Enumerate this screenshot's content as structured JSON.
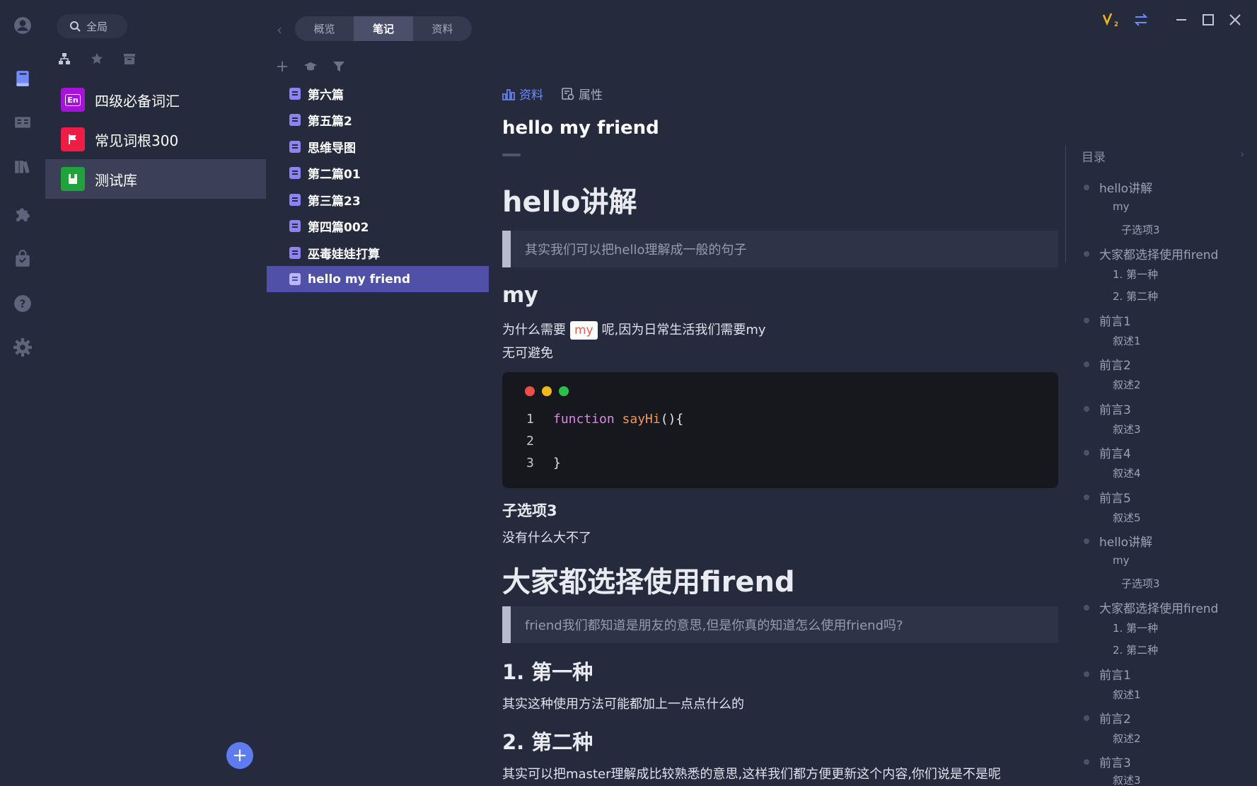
{
  "colors": {
    "accent": "#6e8cff",
    "sidebar_bg": "#262a3d",
    "active_note": "#5051a6",
    "lib_colors": [
      "#a413d7",
      "#ef1c44",
      "#21a33b"
    ]
  },
  "rail": {
    "icons": [
      "avatar-icon",
      "book-icon",
      "cards-icon",
      "library-icon",
      "puzzle-icon",
      "bag-icon",
      "help-icon",
      "gear-icon"
    ]
  },
  "library": {
    "search_label": "全局",
    "items": [
      {
        "label": "四级必备词汇",
        "badge": "En"
      },
      {
        "label": "常见词根300",
        "badge": ""
      },
      {
        "label": "测试库",
        "badge": ""
      }
    ]
  },
  "notes": {
    "tabs": [
      "概览",
      "笔记",
      "资料"
    ],
    "items": [
      "第六篇",
      "第五篇2",
      "思维导图",
      "第二篇01",
      "第三篇23",
      "第四篇002",
      "巫毒娃娃打算",
      "hello my friend"
    ]
  },
  "doc": {
    "tab_material": "资料",
    "tab_props": "属性",
    "title": "hello my friend",
    "h1_a": "hello讲解",
    "quote_a": "其实我们可以把hello理解成一般的句子",
    "h2_my": "my",
    "p_my_pre": "为什么需要",
    "p_my_code": "my",
    "p_my_post": "呢,因为日常生活我们需要my",
    "p_my_2": "无可避免",
    "code": {
      "ln1": "1",
      "ln2": "2",
      "ln3": "3",
      "kw": "function",
      "fn": "sayHi",
      "punc": "(){",
      "close": "}"
    },
    "h4_sub": "子选项3",
    "p_sub": "没有什么大不了",
    "h1_b": "大家都选择使用firend",
    "quote_b": "friend我们都知道是朋友的意思,但是你真的知道怎么使用friend吗?",
    "h3_1": "1. 第一种",
    "p_1": "其实这种使用方法可能都加上一点点什么的",
    "h3_2": "2. 第二种",
    "p_2": "其实可以把master理解成比较熟悉的意思,这样我们都方便更新这个内容,你们说是不是呢"
  },
  "toc": {
    "title": "目录",
    "items": [
      "hello讲解",
      "my",
      "子选项3",
      "大家都选择使用firend",
      "1. 第一种",
      "2. 第二种",
      "前言1",
      "叙述1",
      "前言2",
      "叙述2",
      "前言3",
      "叙述3",
      "前言4",
      "叙述4",
      "前言5",
      "叙述5",
      "hello讲解",
      "my",
      "子选项3",
      "大家都选择使用firend",
      "1. 第一种",
      "2. 第二种",
      "前言1",
      "叙述1",
      "前言2",
      "叙述2",
      "前言3",
      "叙述3"
    ]
  },
  "titlebar": {
    "icons": [
      "v2-badge-icon",
      "swap-icon",
      "minimize-icon",
      "maximize-icon",
      "close-icon"
    ]
  }
}
